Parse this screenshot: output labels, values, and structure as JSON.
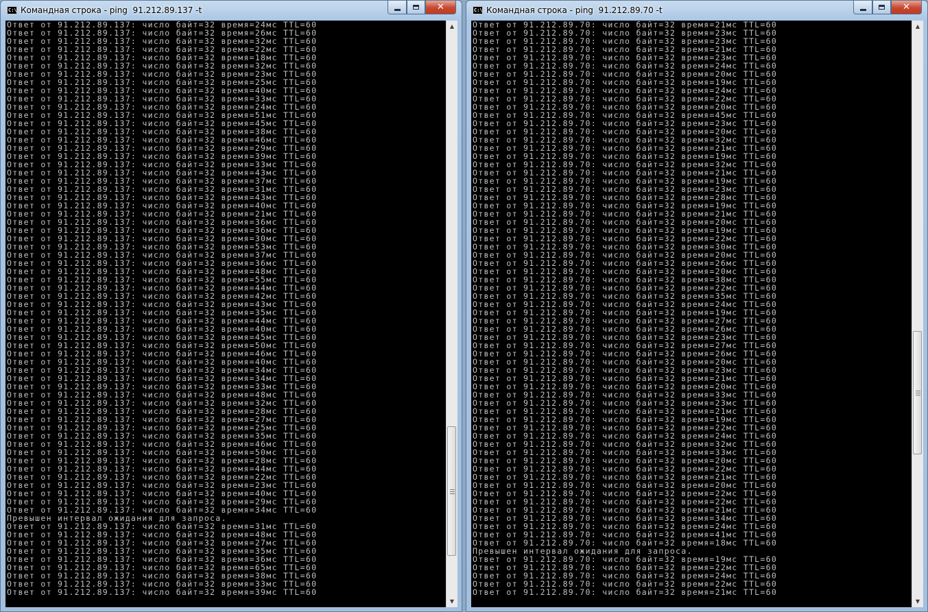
{
  "windows": [
    {
      "title": "Командная строка - ping  91.212.89.137 -t",
      "icon_text": "C:\\",
      "icon": "console-icon",
      "controls": {
        "minimize": "minimize-icon",
        "maximize": "maximize-icon",
        "close": "close-icon"
      },
      "scrollbar": {
        "up_arrow": "▲",
        "down_arrow": "▼",
        "thumb_start_fraction": 0.7,
        "thumb_size_fraction": 0.23
      },
      "lines": [
        "Ответ от 91.212.89.137: число байт=32 время=24мс TTL=60",
        "Ответ от 91.212.89.137: число байт=32 время=26мс TTL=60",
        "Ответ от 91.212.89.137: число байт=32 время=32мс TTL=60",
        "Ответ от 91.212.89.137: число байт=32 время=22мс TTL=60",
        "Ответ от 91.212.89.137: число байт=32 время=18мс TTL=60",
        "Ответ от 91.212.89.137: число байт=32 время=32мс TTL=60",
        "Ответ от 91.212.89.137: число байт=32 время=23мс TTL=60",
        "Ответ от 91.212.89.137: число байт=32 время=25мс TTL=60",
        "Ответ от 91.212.89.137: число байт=32 время=40мс TTL=60",
        "Ответ от 91.212.89.137: число байт=32 время=33мс TTL=60",
        "Ответ от 91.212.89.137: число байт=32 время=24мс TTL=60",
        "Ответ от 91.212.89.137: число байт=32 время=51мс TTL=60",
        "Ответ от 91.212.89.137: число байт=32 время=45мс TTL=60",
        "Ответ от 91.212.89.137: число байт=32 время=38мс TTL=60",
        "Ответ от 91.212.89.137: число байт=32 время=46мс TTL=60",
        "Ответ от 91.212.89.137: число байт=32 время=29мс TTL=60",
        "Ответ от 91.212.89.137: число байт=32 время=39мс TTL=60",
        "Ответ от 91.212.89.137: число байт=32 время=33мс TTL=60",
        "Ответ от 91.212.89.137: число байт=32 время=43мс TTL=60",
        "Ответ от 91.212.89.137: число байт=32 время=37мс TTL=60",
        "Ответ от 91.212.89.137: число байт=32 время=31мс TTL=60",
        "Ответ от 91.212.89.137: число байт=32 время=43мс TTL=60",
        "Ответ от 91.212.89.137: число байт=32 время=40мс TTL=60",
        "Ответ от 91.212.89.137: число байт=32 время=21мс TTL=60",
        "Ответ от 91.212.89.137: число байт=32 время=36мс TTL=60",
        "Ответ от 91.212.89.137: число байт=32 время=36мс TTL=60",
        "Ответ от 91.212.89.137: число байт=32 время=30мс TTL=60",
        "Ответ от 91.212.89.137: число байт=32 время=53мс TTL=60",
        "Ответ от 91.212.89.137: число байт=32 время=37мс TTL=60",
        "Ответ от 91.212.89.137: число байт=32 время=36мс TTL=60",
        "Ответ от 91.212.89.137: число байт=32 время=48мс TTL=60",
        "Ответ от 91.212.89.137: число байт=32 время=55мс TTL=60",
        "Ответ от 91.212.89.137: число байт=32 время=44мс TTL=60",
        "Ответ от 91.212.89.137: число байт=32 время=42мс TTL=60",
        "Ответ от 91.212.89.137: число байт=32 время=43мс TTL=60",
        "Ответ от 91.212.89.137: число байт=32 время=35мс TTL=60",
        "Ответ от 91.212.89.137: число байт=32 время=44мс TTL=60",
        "Ответ от 91.212.89.137: число байт=32 время=40мс TTL=60",
        "Ответ от 91.212.89.137: число байт=32 время=45мс TTL=60",
        "Ответ от 91.212.89.137: число байт=32 время=50мс TTL=60",
        "Ответ от 91.212.89.137: число байт=32 время=46мс TTL=60",
        "Ответ от 91.212.89.137: число байт=32 время=40мс TTL=60",
        "Ответ от 91.212.89.137: число байт=32 время=34мс TTL=60",
        "Ответ от 91.212.89.137: число байт=32 время=34мс TTL=60",
        "Ответ от 91.212.89.137: число байт=32 время=33мс TTL=60",
        "Ответ от 91.212.89.137: число байт=32 время=48мс TTL=60",
        "Ответ от 91.212.89.137: число байт=32 время=32мс TTL=60",
        "Ответ от 91.212.89.137: число байт=32 время=28мс TTL=60",
        "Ответ от 91.212.89.137: число байт=32 время=27мс TTL=60",
        "Ответ от 91.212.89.137: число байт=32 время=25мс TTL=60",
        "Ответ от 91.212.89.137: число байт=32 время=35мс TTL=60",
        "Ответ от 91.212.89.137: число байт=32 время=46мс TTL=60",
        "Ответ от 91.212.89.137: число байт=32 время=50мс TTL=60",
        "Ответ от 91.212.89.137: число байт=32 время=28мс TTL=60",
        "Ответ от 91.212.89.137: число байт=32 время=44мс TTL=60",
        "Ответ от 91.212.89.137: число байт=32 время=22мс TTL=60",
        "Ответ от 91.212.89.137: число байт=32 время=23мс TTL=60",
        "Ответ от 91.212.89.137: число байт=32 время=40мс TTL=60",
        "Ответ от 91.212.89.137: число байт=32 время=29мс TTL=60",
        "Ответ от 91.212.89.137: число байт=32 время=34мс TTL=60",
        "Превышен интервал ожидания для запроса.",
        "Ответ от 91.212.89.137: число байт=32 время=31мс TTL=60",
        "Ответ от 91.212.89.137: число байт=32 время=48мс TTL=60",
        "Ответ от 91.212.89.137: число байт=32 время=27мс TTL=60",
        "Ответ от 91.212.89.137: число байт=32 время=35мс TTL=60",
        "Ответ от 91.212.89.137: число байт=32 время=36мс TTL=60",
        "Ответ от 91.212.89.137: число байт=32 время=65мс TTL=60",
        "Ответ от 91.212.89.137: число байт=32 время=38мс TTL=60",
        "Ответ от 91.212.89.137: число байт=32 время=33мс TTL=60",
        "Ответ от 91.212.89.137: число байт=32 время=39мс TTL=60"
      ]
    },
    {
      "title": "Командная строка - ping  91.212.89.70 -t",
      "icon_text": "C:\\",
      "icon": "console-icon",
      "controls": {
        "minimize": "minimize-icon",
        "maximize": "maximize-icon",
        "close": "close-icon"
      },
      "scrollbar": {
        "up_arrow": "▲",
        "down_arrow": "▼",
        "thumb_start_fraction": 0.53,
        "thumb_size_fraction": 0.22
      },
      "lines": [
        "Ответ от 91.212.89.70: число байт=32 время=21мс TTL=60",
        "Ответ от 91.212.89.70: число байт=32 время=23мс TTL=60",
        "Ответ от 91.212.89.70: число байт=32 время=23мс TTL=60",
        "Ответ от 91.212.89.70: число байт=32 время=21мс TTL=60",
        "Ответ от 91.212.89.70: число байт=32 время=23мс TTL=60",
        "Ответ от 91.212.89.70: число байт=32 время=24мс TTL=60",
        "Ответ от 91.212.89.70: число байт=32 время=20мс TTL=60",
        "Ответ от 91.212.89.70: число байт=32 время=19мс TTL=60",
        "Ответ от 91.212.89.70: число байт=32 время=24мс TTL=60",
        "Ответ от 91.212.89.70: число байт=32 время=22мс TTL=60",
        "Ответ от 91.212.89.70: число байт=32 время=20мс TTL=60",
        "Ответ от 91.212.89.70: число байт=32 время=45мс TTL=60",
        "Ответ от 91.212.89.70: число байт=32 время=23мс TTL=60",
        "Ответ от 91.212.89.70: число байт=32 время=20мс TTL=60",
        "Ответ от 91.212.89.70: число байт=32 время=32мс TTL=60",
        "Ответ от 91.212.89.70: число байт=32 время=21мс TTL=60",
        "Ответ от 91.212.89.70: число байт=32 время=19мс TTL=60",
        "Ответ от 91.212.89.70: число байт=32 время=32мс TTL=60",
        "Ответ от 91.212.89.70: число байт=32 время=21мс TTL=60",
        "Ответ от 91.212.89.70: число байт=32 время=19мс TTL=60",
        "Ответ от 91.212.89.70: число байт=32 время=23мс TTL=60",
        "Ответ от 91.212.89.70: число байт=32 время=28мс TTL=60",
        "Ответ от 91.212.89.70: число байт=32 время=19мс TTL=60",
        "Ответ от 91.212.89.70: число байт=32 время=21мс TTL=60",
        "Ответ от 91.212.89.70: число байт=32 время=20мс TTL=60",
        "Ответ от 91.212.89.70: число байт=32 время=19мс TTL=60",
        "Ответ от 91.212.89.70: число байт=32 время=22мс TTL=60",
        "Ответ от 91.212.89.70: число байт=32 время=30мс TTL=60",
        "Ответ от 91.212.89.70: число байт=32 время=20мс TTL=60",
        "Ответ от 91.212.89.70: число байт=32 время=26мс TTL=60",
        "Ответ от 91.212.89.70: число байт=32 время=20мс TTL=60",
        "Ответ от 91.212.89.70: число байт=32 время=38мс TTL=60",
        "Ответ от 91.212.89.70: число байт=32 время=22мс TTL=60",
        "Ответ от 91.212.89.70: число байт=32 время=35мс TTL=60",
        "Ответ от 91.212.89.70: число байт=32 время=24мс TTL=60",
        "Ответ от 91.212.89.70: число байт=32 время=19мс TTL=60",
        "Ответ от 91.212.89.70: число байт=32 время=27мс TTL=60",
        "Ответ от 91.212.89.70: число байт=32 время=26мс TTL=60",
        "Ответ от 91.212.89.70: число байт=32 время=23мс TTL=60",
        "Ответ от 91.212.89.70: число байт=32 время=27мс TTL=60",
        "Ответ от 91.212.89.70: число байт=32 время=26мс TTL=60",
        "Ответ от 91.212.89.70: число байт=32 время=20мс TTL=60",
        "Ответ от 91.212.89.70: число байт=32 время=23мс TTL=60",
        "Ответ от 91.212.89.70: число байт=32 время=21мс TTL=60",
        "Ответ от 91.212.89.70: число байт=32 время=20мс TTL=60",
        "Ответ от 91.212.89.70: число байт=32 время=33мс TTL=60",
        "Ответ от 91.212.89.70: число байт=32 время=23мс TTL=60",
        "Ответ от 91.212.89.70: число байт=32 время=21мс TTL=60",
        "Ответ от 91.212.89.70: число байт=32 время=19мс TTL=60",
        "Ответ от 91.212.89.70: число байт=32 время=22мс TTL=60",
        "Ответ от 91.212.89.70: число байт=32 время=24мс TTL=60",
        "Ответ от 91.212.89.70: число байт=32 время=32мс TTL=60",
        "Ответ от 91.212.89.70: число байт=32 время=33мс TTL=60",
        "Ответ от 91.212.89.70: число байт=32 время=20мс TTL=60",
        "Ответ от 91.212.89.70: число байт=32 время=22мс TTL=60",
        "Ответ от 91.212.89.70: число байт=32 время=21мс TTL=60",
        "Ответ от 91.212.89.70: число байт=32 время=20мс TTL=60",
        "Ответ от 91.212.89.70: число байт=32 время=22мс TTL=60",
        "Ответ от 91.212.89.70: число байт=32 время=22мс TTL=60",
        "Ответ от 91.212.89.70: число байт=32 время=21мс TTL=60",
        "Ответ от 91.212.89.70: число байт=32 время=34мс TTL=60",
        "Ответ от 91.212.89.70: число байт=32 время=24мс TTL=60",
        "Ответ от 91.212.89.70: число байт=32 время=41мс TTL=60",
        "Ответ от 91.212.89.70: число байт=32 время=18мс TTL=60",
        "Превышен интервал ожидания для запроса.",
        "Ответ от 91.212.89.70: число байт=32 время=19мс TTL=60",
        "Ответ от 91.212.89.70: число байт=32 время=22мс TTL=60",
        "Ответ от 91.212.89.70: число байт=32 время=24мс TTL=60",
        "Ответ от 91.212.89.70: число байт=32 время=22мс TTL=60",
        "Ответ от 91.212.89.70: число байт=32 время=21мс TTL=60"
      ]
    }
  ]
}
